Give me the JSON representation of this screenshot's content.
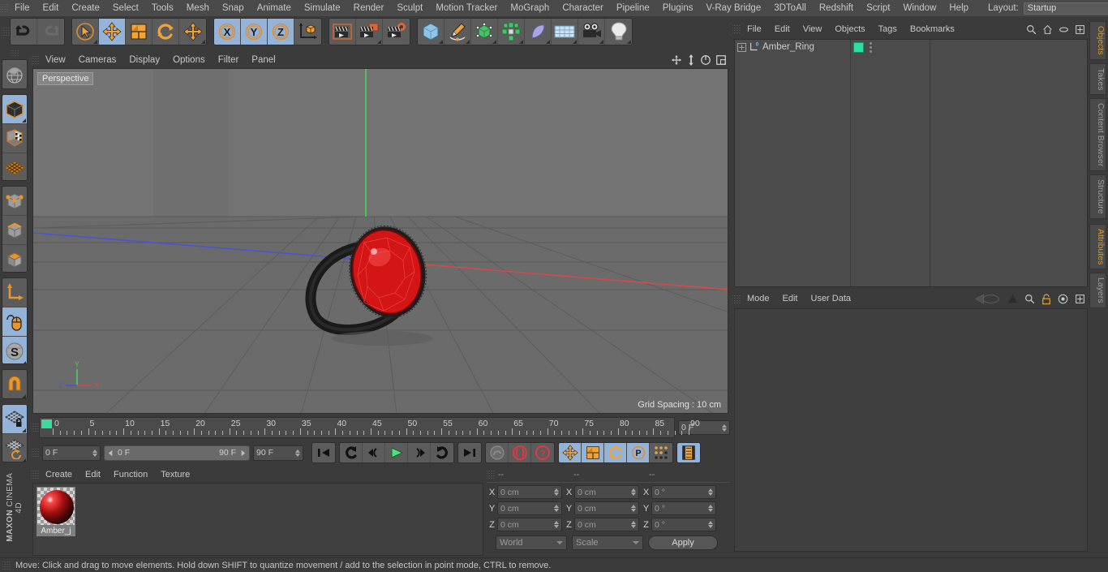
{
  "app": {
    "name": "MAXON",
    "product": "CINEMA 4D"
  },
  "menubar": {
    "items": [
      "File",
      "Edit",
      "Create",
      "Select",
      "Tools",
      "Mesh",
      "Snap",
      "Animate",
      "Simulate",
      "Render",
      "Sculpt",
      "Motion Tracker",
      "MoGraph",
      "Character",
      "Pipeline",
      "Plugins",
      "V-Ray Bridge",
      "3DToAll",
      "Redshift",
      "Script",
      "Window",
      "Help"
    ],
    "layout_label": "Layout:",
    "layout_value": "Startup",
    "right_icons": [
      "search-icon",
      "home-icon",
      "minimize-icon",
      "maximize-icon"
    ]
  },
  "toolbar": {
    "groups": [
      {
        "name": "history",
        "buttons": [
          {
            "name": "undo-button",
            "icon": "undo-arrow",
            "active": false,
            "corner": false
          },
          {
            "name": "redo-button",
            "icon": "redo-arrow",
            "active": false,
            "corner": false
          }
        ]
      },
      {
        "name": "transform",
        "buttons": [
          {
            "name": "live-selection-tool",
            "icon": "cursor-circle",
            "active": false,
            "corner": true
          },
          {
            "name": "move-tool",
            "icon": "move-arrows",
            "active": true,
            "corner": false
          },
          {
            "name": "scale-tool",
            "icon": "scale-box",
            "active": false,
            "corner": false
          },
          {
            "name": "rotate-tool",
            "icon": "rotate-arrows",
            "active": false,
            "corner": false
          },
          {
            "name": "move-alt-tool",
            "icon": "move-arrows",
            "active": false,
            "corner": true
          }
        ]
      },
      {
        "name": "axis-lock",
        "buttons": [
          {
            "name": "lock-x-axis",
            "icon": "x-axis",
            "active": true,
            "corner": false
          },
          {
            "name": "lock-y-axis",
            "icon": "y-axis",
            "active": true,
            "corner": false
          },
          {
            "name": "lock-z-axis",
            "icon": "z-axis",
            "active": true,
            "corner": false
          },
          {
            "name": "world-object-coordinates",
            "icon": "coordinate-cube",
            "active": false,
            "corner": false
          }
        ]
      },
      {
        "name": "render",
        "buttons": [
          {
            "name": "render-view-button",
            "icon": "clapper",
            "active": false,
            "corner": false
          },
          {
            "name": "render-region-button",
            "icon": "clapper-region",
            "active": false,
            "corner": true
          },
          {
            "name": "render-settings-button",
            "icon": "clapper-gear",
            "active": false,
            "corner": false
          }
        ]
      },
      {
        "name": "objects",
        "buttons": [
          {
            "name": "add-cube-button",
            "icon": "cube",
            "active": false,
            "corner": true
          },
          {
            "name": "add-spline-button",
            "icon": "pen-spline",
            "active": false,
            "corner": true
          },
          {
            "name": "add-nurbs-button",
            "icon": "nurbs-cube",
            "active": false,
            "corner": true
          },
          {
            "name": "add-array-button",
            "icon": "array-cluster",
            "active": false,
            "corner": true
          },
          {
            "name": "add-deformer-button",
            "icon": "bend-deformer",
            "active": false,
            "corner": true
          },
          {
            "name": "add-floor-button",
            "icon": "floor-grid",
            "active": false,
            "corner": true
          },
          {
            "name": "add-camera-button",
            "icon": "camera",
            "active": false,
            "corner": true
          },
          {
            "name": "add-light-button",
            "icon": "lightbulb",
            "active": false,
            "corner": true
          }
        ]
      }
    ]
  },
  "lefttools": {
    "groups": [
      {
        "name": "world-axis",
        "buttons": [
          {
            "name": "make-editable-tool",
            "icon": "globe-wire",
            "active": false,
            "corner": false
          }
        ]
      },
      {
        "name": "modes",
        "buttons": [
          {
            "name": "model-mode",
            "icon": "solid-cube",
            "active": true,
            "corner": true
          },
          {
            "name": "texture-mode",
            "icon": "checker-cube",
            "active": false,
            "corner": false
          },
          {
            "name": "uv-mesh-mode",
            "icon": "uv-grid",
            "active": false,
            "corner": false
          }
        ]
      },
      {
        "name": "components",
        "buttons": [
          {
            "name": "points-mode",
            "icon": "point-cube",
            "active": false,
            "corner": false
          },
          {
            "name": "edges-mode",
            "icon": "edge-cube",
            "active": false,
            "corner": false
          },
          {
            "name": "polygons-mode",
            "icon": "polygon-cube",
            "active": false,
            "corner": false
          }
        ]
      },
      {
        "name": "axis",
        "buttons": [
          {
            "name": "enable-axis-modification",
            "icon": "axis-arrow",
            "active": false,
            "corner": false
          },
          {
            "name": "viewport-solo",
            "icon": "mouse-cursor",
            "active": true,
            "corner": false
          },
          {
            "name": "soft-selection",
            "icon": "s-sphere",
            "active": true,
            "corner": true
          }
        ]
      },
      {
        "name": "snap",
        "buttons": [
          {
            "name": "enable-snap",
            "icon": "magnet",
            "active": false,
            "corner": true
          }
        ]
      },
      {
        "name": "workplane",
        "buttons": [
          {
            "name": "lock-workplane",
            "icon": "grid-lock",
            "active": true,
            "corner": true
          },
          {
            "name": "planar-workplane",
            "icon": "grid-rotate",
            "active": false,
            "corner": true
          }
        ]
      }
    ]
  },
  "viewport": {
    "menu": [
      "View",
      "Cameras",
      "Display",
      "Options",
      "Filter",
      "Panel"
    ],
    "perspective_label": "Perspective",
    "grid_spacing": "Grid Spacing : 10 cm",
    "axis_labels": {
      "x": "X",
      "y": "Y",
      "z": "Z"
    },
    "right_icons": [
      "pan-icon",
      "zoom-icon",
      "rotate-icon",
      "layout-icon"
    ],
    "colors": {
      "background": "#6f6f6f",
      "x_axis": "#d34b4b",
      "z_axis": "#4b54d3",
      "y_axis": "#4bd35a",
      "object": "#e02020"
    }
  },
  "timeline": {
    "ticks": [
      "0",
      "5",
      "10",
      "15",
      "20",
      "25",
      "30",
      "35",
      "40",
      "45",
      "50",
      "55",
      "60",
      "65",
      "70",
      "75",
      "80",
      "85",
      "90"
    ],
    "current_frame": "0 F",
    "playhead_frame": 0
  },
  "playbar": {
    "current_frame": "0 F",
    "range_start": "0 F",
    "range_end": "90 F",
    "end_frame": "90 F",
    "buttons": [
      {
        "name": "go-to-start-button",
        "icon": "skip-start",
        "blue": false
      },
      {
        "name": "go-to-previous-key-button",
        "icon": "prev-key",
        "blue": false
      },
      {
        "name": "go-to-previous-frame-button",
        "icon": "step-back",
        "blue": false
      },
      {
        "name": "play-button",
        "icon": "play",
        "blue": false
      },
      {
        "name": "go-to-next-frame-button",
        "icon": "step-forward",
        "blue": false
      },
      {
        "name": "go-to-next-key-button",
        "icon": "next-key",
        "blue": false
      },
      {
        "name": "go-to-end-button",
        "icon": "skip-end",
        "blue": false
      },
      {
        "name": "record-active-objects-button",
        "icon": "keyframe-circle",
        "blue": false
      },
      {
        "name": "autokeying-button",
        "icon": "autokey-circle",
        "blue": false
      },
      {
        "name": "keyframe-selection-button",
        "icon": "question-circle",
        "blue": false
      },
      {
        "name": "position-key-button",
        "icon": "move-arrows",
        "blue": true
      },
      {
        "name": "scale-key-button",
        "icon": "scale-box",
        "blue": true
      },
      {
        "name": "rotation-key-button",
        "icon": "rotate-arrows",
        "blue": true
      },
      {
        "name": "parameter-key-button",
        "icon": "p-circle",
        "blue": true
      },
      {
        "name": "point-level-animation-button",
        "icon": "dot-matrix",
        "blue": false
      },
      {
        "name": "timeline-button",
        "icon": "film-strip",
        "blue": true
      }
    ]
  },
  "material_manager": {
    "menu": [
      "Create",
      "Edit",
      "Function",
      "Texture"
    ],
    "materials": [
      {
        "name": "Amber_j"
      }
    ]
  },
  "coordinates": {
    "headers": [
      "--",
      "--",
      "--"
    ],
    "rows": [
      {
        "axis": "X",
        "position": "0 cm",
        "size": "0 cm",
        "rotation": "0 °"
      },
      {
        "axis": "Y",
        "position": "0 cm",
        "size": "0 cm",
        "rotation": "0 °"
      },
      {
        "axis": "Z",
        "position": "0 cm",
        "size": "0 cm",
        "rotation": "0 °"
      }
    ],
    "coord_system": "World",
    "size_mode": "Scale",
    "apply_label": "Apply"
  },
  "object_manager": {
    "menu": [
      "File",
      "Edit",
      "View",
      "Objects",
      "Tags",
      "Bookmarks"
    ],
    "right_icons": [
      "search-icon",
      "home-icon",
      "ellipse-icon",
      "expand-icon"
    ],
    "objects": [
      {
        "name": "Amber_Ring",
        "layer": "0",
        "tag_color": "#2fdfa0"
      }
    ]
  },
  "attribute_manager": {
    "menu": [
      "Mode",
      "Edit",
      "User Data"
    ],
    "right_icons": [
      "history-icon",
      "arrow-up-icon",
      "search-icon",
      "lock-icon",
      "target-icon",
      "expand-icon"
    ]
  },
  "right_dock_tabs": [
    {
      "label": "Objects",
      "accent": true
    },
    {
      "label": "Takes",
      "accent": false
    },
    {
      "label": "Content Browser",
      "accent": false
    },
    {
      "label": "Structure",
      "accent": false
    },
    {
      "label": "Attributes",
      "accent": true
    },
    {
      "label": "Layers",
      "accent": false
    }
  ],
  "statusbar": {
    "text": "Move: Click and drag to move elements. Hold down SHIFT to quantize movement / add to the selection in point mode, CTRL to remove."
  }
}
